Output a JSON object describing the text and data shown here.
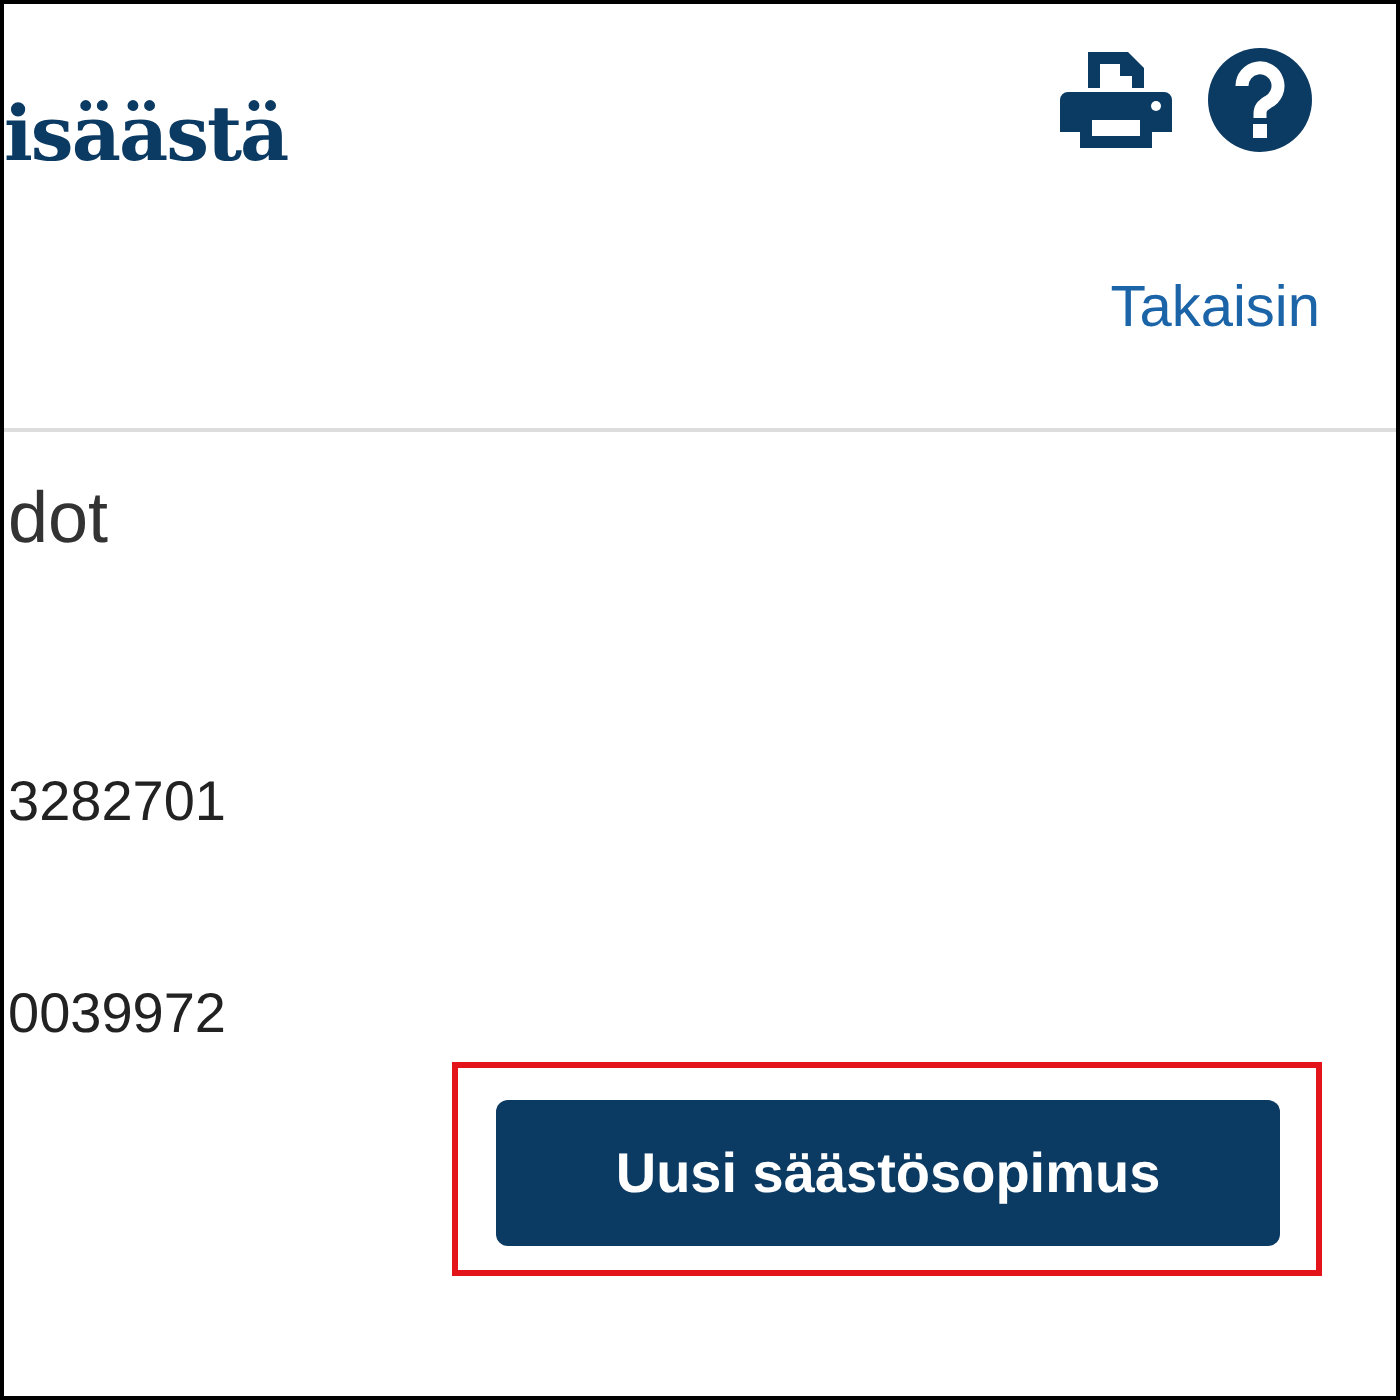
{
  "header": {
    "title": "isäästä"
  },
  "actions": {
    "back_link": "Takaisin"
  },
  "section": {
    "heading": "dot"
  },
  "fields": [
    {
      "value": "3282701"
    },
    {
      "value": "0039972"
    }
  ],
  "button": {
    "label": "Uusi säästösopimus",
    "highlighted": true
  }
}
